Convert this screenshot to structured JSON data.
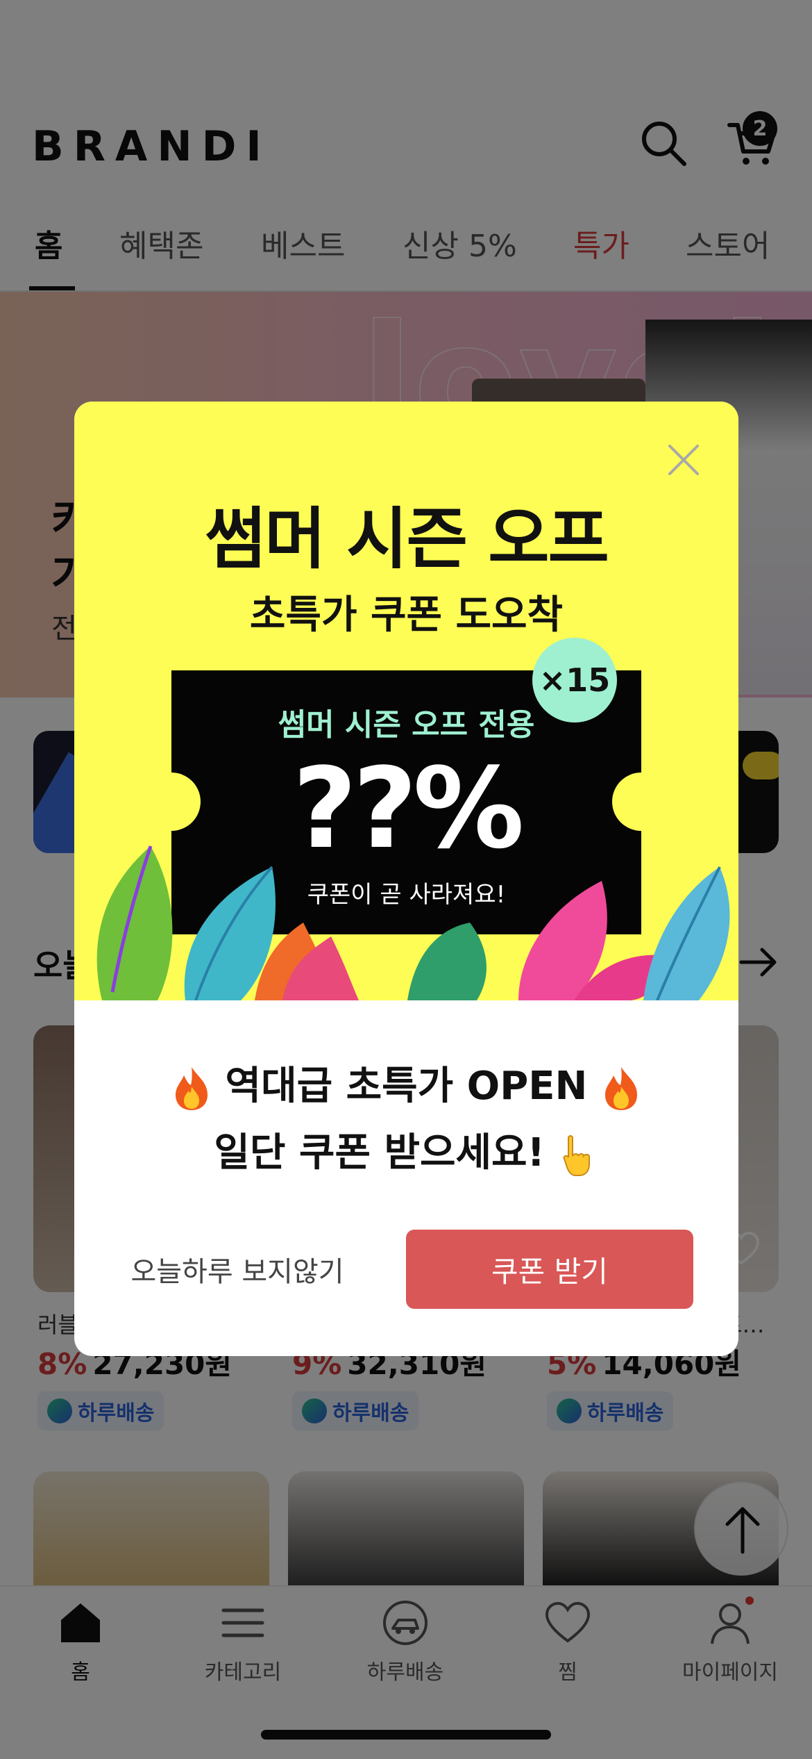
{
  "header": {
    "logo": "BRANDI",
    "cart_count": "2"
  },
  "tabs": [
    {
      "label": "홈",
      "active": true
    },
    {
      "label": "혜택존"
    },
    {
      "label": "베스트"
    },
    {
      "label": "신상 5%"
    },
    {
      "label": "특가",
      "highlight": "#d63a3a"
    },
    {
      "label": "스토어"
    }
  ],
  "banner": {
    "bg_word": "lovely",
    "title_line1": "카",
    "title_line2": "가",
    "subtitle": "전"
  },
  "section": {
    "title": "오늘"
  },
  "products": [
    {
      "name": "러블",
      "discount": "8%",
      "price": "27,230원",
      "badge": "하루배송"
    },
    {
      "name": "",
      "discount": "9%",
      "price": "32,310원",
      "badge": "하루배송"
    },
    {
      "name": "트…",
      "discount": "5%",
      "price": "14,060원",
      "badge": "하루배송"
    }
  ],
  "bottom_nav": [
    {
      "label": "홈",
      "icon": "home-icon",
      "active": true
    },
    {
      "label": "카테고리",
      "icon": "menu-icon"
    },
    {
      "label": "하루배송",
      "icon": "delivery-icon"
    },
    {
      "label": "찜",
      "icon": "heart-icon"
    },
    {
      "label": "마이페이지",
      "icon": "person-icon"
    }
  ],
  "modal": {
    "title": "썸머 시즌 오프",
    "subtitle": "초특가 쿠폰 도오착",
    "multiplier": "×15",
    "ticket_label": "썸머 시즌 오프 전용",
    "ticket_percent": "??%",
    "ticket_note": "쿠폰이 곧 사라져요!",
    "message_line1": "역대급 초특가 OPEN",
    "message_line2": "일단 쿠폰 받으세요!",
    "dismiss_label": "오늘하루 보지않기",
    "coupon_button_label": "쿠폰 받기"
  },
  "colors": {
    "promo_bg": "#fdfd55",
    "ticket_bg": "#050505",
    "accent_mint": "#9ff0d0",
    "coupon_button": "#d95757",
    "sale_red": "#d63a3a"
  }
}
